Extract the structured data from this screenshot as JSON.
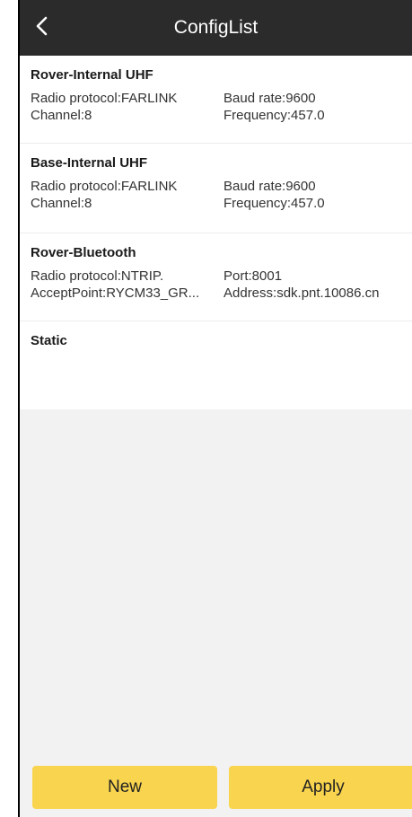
{
  "header": {
    "title": "ConfigList",
    "back_icon": "chevron-left-icon"
  },
  "configs": [
    {
      "title": "Rover-Internal UHF",
      "row1_left": "Radio protocol:FARLINK",
      "row1_right": "Baud rate:9600",
      "row2_left": "Channel:8",
      "row2_right": "Frequency:457.0"
    },
    {
      "title": "Base-Internal UHF",
      "row1_left": "Radio protocol:FARLINK",
      "row1_right": "Baud rate:9600",
      "row2_left": "Channel:8",
      "row2_right": "Frequency:457.0"
    },
    {
      "title": "Rover-Bluetooth",
      "row1_left": "Radio protocol:NTRIP.",
      "row1_right": "Port:8001",
      "row2_left": "AcceptPoint:RYCM33_GR...",
      "row2_right": "Address:sdk.pnt.10086.cn"
    },
    {
      "title": "Static"
    }
  ],
  "buttons": {
    "new_label": "New",
    "apply_label": "Apply"
  },
  "colors": {
    "header_bg": "#2b2b2b",
    "accent_button": "#f9d44e",
    "page_bg": "#f2f2f2"
  }
}
